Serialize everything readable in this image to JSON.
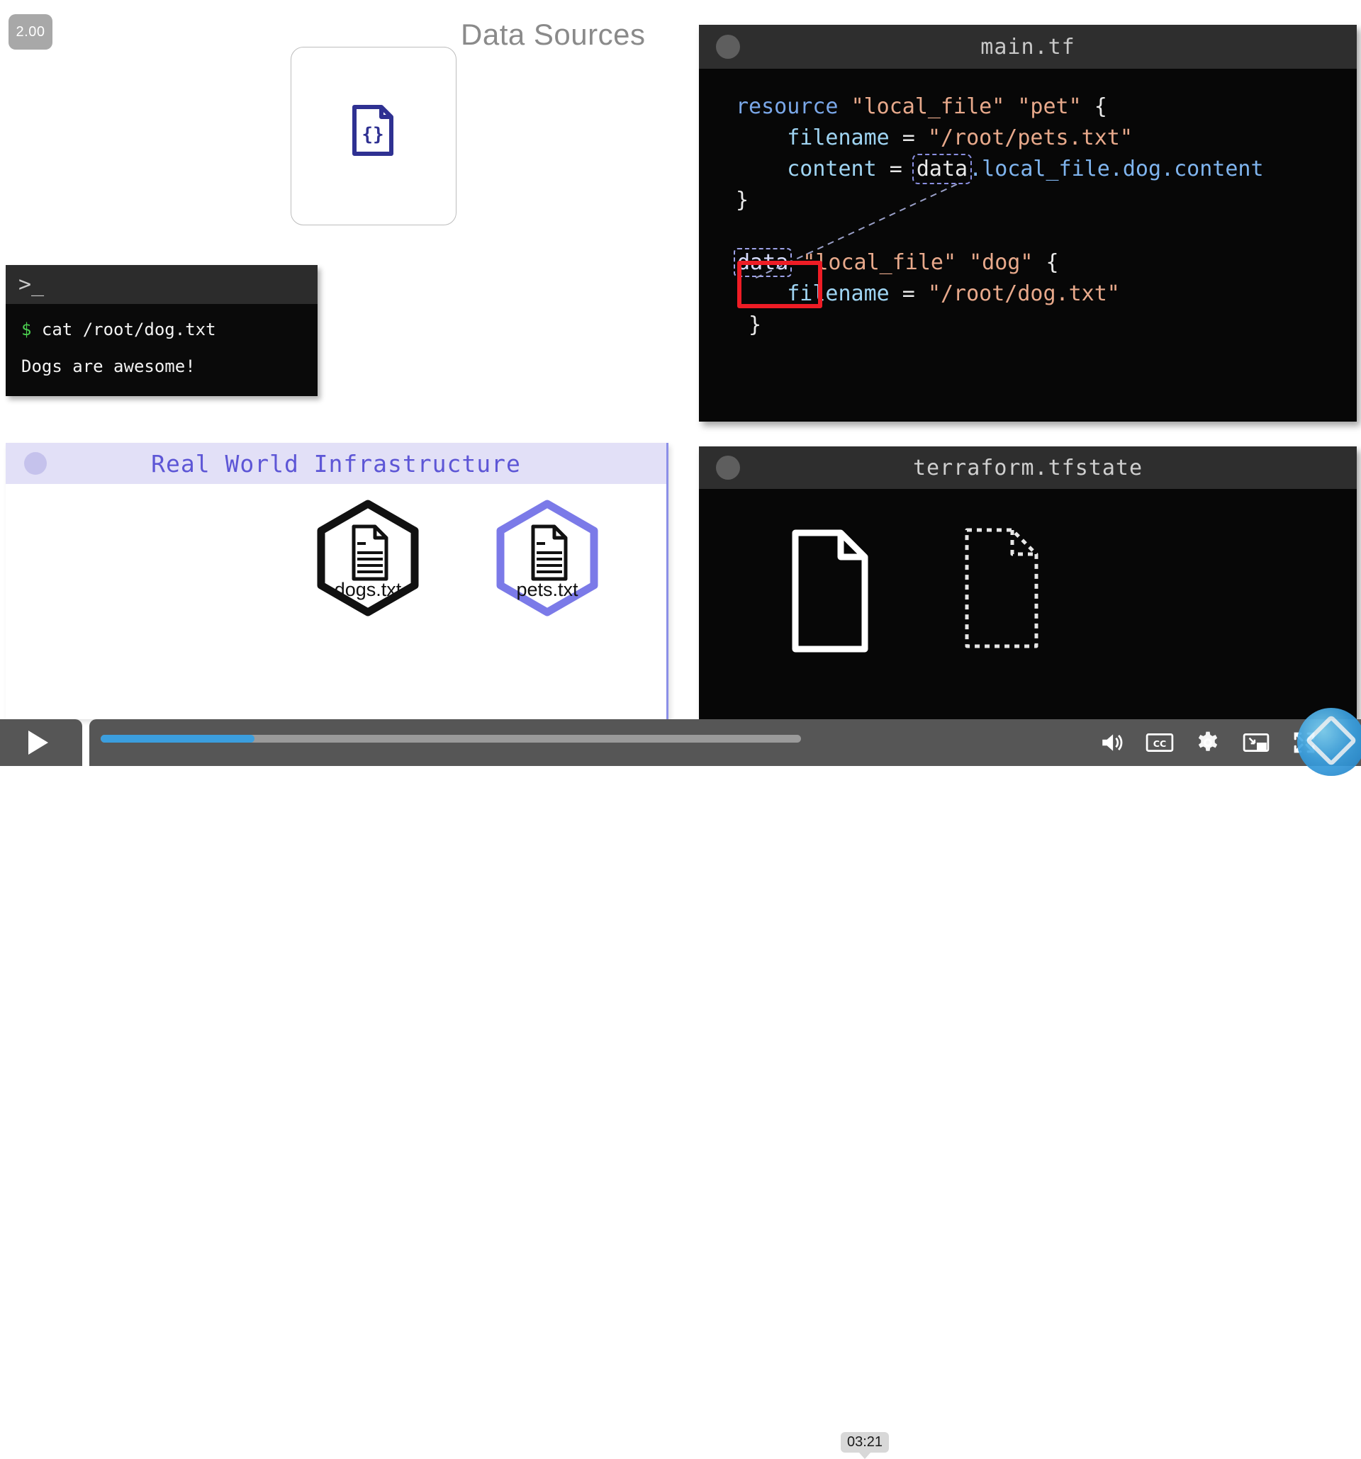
{
  "player": {
    "speed_badge": "2.00",
    "play_label": "▶",
    "current_time_tooltip": "03:21",
    "progress_percent": 22,
    "controls": [
      {
        "name": "volume-icon",
        "label": "Volume"
      },
      {
        "name": "captions-icon",
        "label": "CC"
      },
      {
        "name": "settings-gear-icon",
        "label": "Settings"
      },
      {
        "name": "miniplayer-icon",
        "label": "Miniplayer"
      },
      {
        "name": "fullscreen-icon",
        "label": "Fullscreen"
      }
    ]
  },
  "data_sources": {
    "title": "Data Sources",
    "icon_name": "json-file-icon",
    "icon_glyph": "{}"
  },
  "terminal": {
    "prompt_glyph": ">_",
    "lines": [
      {
        "prefix": "$",
        "text": " cat /root/dog.txt"
      },
      {
        "prefix": "",
        "text": "Dogs are awesome!"
      }
    ]
  },
  "main_tf": {
    "title": "main.tf",
    "code_lines": [
      [
        {
          "t": "resource ",
          "c": "kw"
        },
        {
          "t": "\"local_file\" \"pet\"",
          "c": "str"
        },
        {
          "t": " {",
          "c": "plain"
        }
      ],
      [
        {
          "t": "    ",
          "c": "plain"
        },
        {
          "t": "filename",
          "c": "attr"
        },
        {
          "t": " = ",
          "c": "plain"
        },
        {
          "t": "\"/root/pets.txt\"",
          "c": "str"
        }
      ],
      [
        {
          "t": "    ",
          "c": "plain"
        },
        {
          "t": "content",
          "c": "attr"
        },
        {
          "t": " = ",
          "c": "plain"
        },
        {
          "t": "data",
          "c": "data-out"
        },
        {
          "t": ".local_file.dog.content",
          "c": "ref"
        }
      ],
      [
        {
          "t": "}",
          "c": "plain"
        }
      ],
      [
        {
          "t": "",
          "c": "plain"
        }
      ],
      [
        {
          "t": "data",
          "c": "data-hl"
        },
        {
          "t": " \"local_file\" \"dog\"",
          "c": "str"
        },
        {
          "t": " {",
          "c": "plain"
        }
      ],
      [
        {
          "t": "    ",
          "c": "plain"
        },
        {
          "t": "filename",
          "c": "attr"
        },
        {
          "t": " = ",
          "c": "plain"
        },
        {
          "t": "\"/root/dog.txt\"",
          "c": "str"
        }
      ],
      [
        {
          "t": " }",
          "c": "plain"
        }
      ]
    ],
    "highlight_box_color": "#ee1c25",
    "highlight_target": "data"
  },
  "tfstate": {
    "title": "terraform.tfstate",
    "documents": [
      {
        "name": "state-doc-solid",
        "style": "solid"
      },
      {
        "name": "state-doc-dashed",
        "style": "dashed"
      }
    ]
  },
  "infrastructure": {
    "title": "Real World Infrastructure",
    "nodes": [
      {
        "name": "node-dogs-txt",
        "label": "dogs.txt",
        "color": "#111111"
      },
      {
        "name": "node-pets-txt",
        "label": "pets.txt",
        "color": "#7b7ae8"
      }
    ]
  },
  "colors": {
    "accent_purple": "#5d56d6",
    "node_purple": "#7b7ae8",
    "progress_blue": "#3b9ede",
    "highlight_red": "#ee1c25",
    "terminal_green": "#4ccf50"
  }
}
